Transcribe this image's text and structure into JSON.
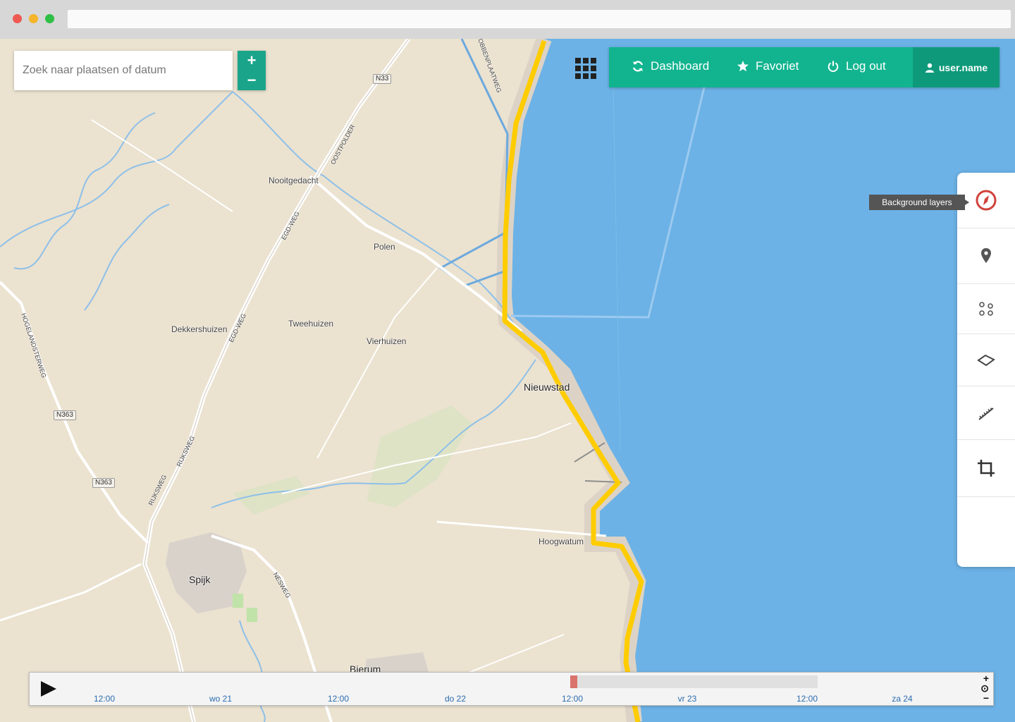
{
  "browser": {
    "dots": [
      "#ee5a52",
      "#f4b52a",
      "#2fbf44"
    ]
  },
  "search": {
    "placeholder": "Zoek naar plaatsen of datum"
  },
  "zoom": {
    "in_label": "+",
    "out_label": "−"
  },
  "nav": {
    "dashboard_label": "Dashboard",
    "favoriet_label": "Favoriet",
    "logout_label": "Log out",
    "user_label": "user.name",
    "accent": "#12b48f"
  },
  "map": {
    "places": [
      "Nooitgedacht",
      "Polen",
      "Tweehuizen",
      "Dekkershuizen",
      "Vierhuizen",
      "Nieuwstad",
      "Hoogwatum",
      "Spijk",
      "Bierum"
    ],
    "roads": [
      "OOSTPOLDER",
      "EGD-WEG",
      "HOGELANDSTERWEG",
      "RIJKSWEG",
      "NESWEG",
      "ROBBENPLAATWEG"
    ],
    "shields": [
      "N33",
      "N363",
      "N363"
    ],
    "water_color": "#6cb2e6",
    "land_color": "#ebe2d0",
    "dike_color": "#ffcc00"
  },
  "sidebar": {
    "tooltip": "Background layers",
    "tools": [
      "background-layers",
      "marker",
      "points",
      "polygon",
      "measure",
      "crop"
    ]
  },
  "timeline": {
    "ticks": [
      "12:00",
      "wo 21",
      "12:00",
      "do 22",
      "12:00",
      "vr 23",
      "12:00",
      "za 24"
    ],
    "zoom_in": "+",
    "reset": "⊙",
    "zoom_out": "−"
  }
}
